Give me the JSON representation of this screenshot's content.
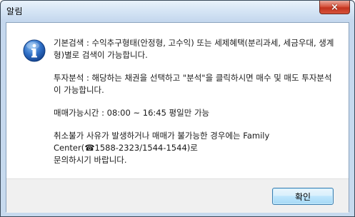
{
  "window": {
    "title": "알림",
    "close_label": "×"
  },
  "message": {
    "paragraphs": [
      "기본검색 : 수익추구형태(안정형, 고수익) 또는 세제혜택(분리과세, 세금우대, 생계형)별로 검색이 가능합니다.",
      "투자분석 : 해당하는 채권을 선택하고 \"분석\"을 클릭하시면 매수 및 매도 투자분석이 가능합니다.",
      "매매가능시간 : 08:00 ~ 16:45 평일만 가능",
      "취소불가 사유가 발생하거나 매매가 불가능한 경우에는 Family Center(☎1588-2323/1544-1544)로\n문의하시기 바랍니다."
    ]
  },
  "buttons": {
    "ok_label": "확인"
  },
  "icon": {
    "name": "info-icon",
    "color": "#2f6fc6"
  }
}
